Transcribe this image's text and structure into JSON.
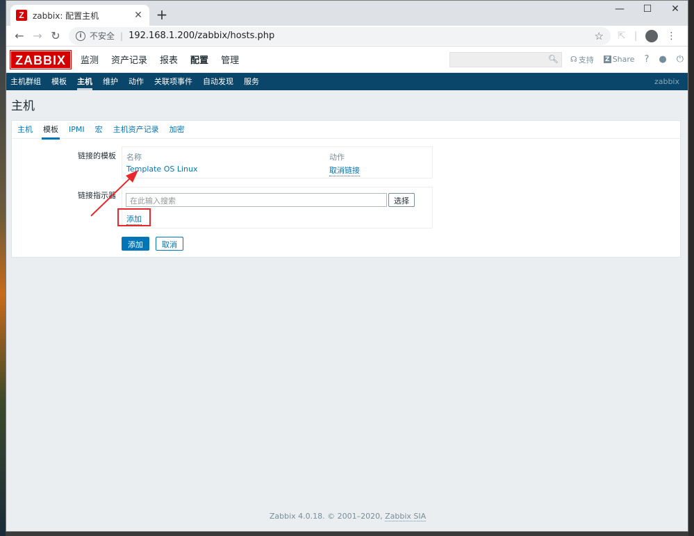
{
  "browser": {
    "tab_title": "zabbix: 配置主机",
    "security_label": "不安全",
    "url": "192.168.1.200/zabbix/hosts.php"
  },
  "header": {
    "logo": "ZABBIX",
    "menu": [
      "监测",
      "资产记录",
      "报表",
      "配置",
      "管理"
    ],
    "active_menu": "配置",
    "support_label": "支持",
    "share_label": "Share",
    "help_label": "?"
  },
  "subnav": {
    "items": [
      "主机群组",
      "模板",
      "主机",
      "维护",
      "动作",
      "关联项事件",
      "自动发现",
      "服务"
    ],
    "active": "主机",
    "user": "zabbix"
  },
  "page": {
    "title": "主机",
    "tabs": [
      "主机",
      "模板",
      "IPMI",
      "宏",
      "主机资产记录",
      "加密"
    ],
    "active_tab": "模板"
  },
  "form": {
    "linked_templates_label": "链接的模板",
    "col_name": "名称",
    "col_action": "动作",
    "template_name": "Template OS Linux",
    "unlink_label": "取消链接",
    "link_new_label": "链接指示器",
    "search_placeholder": "在此输入搜索",
    "select_button": "选择",
    "add_link": "添加",
    "add_button": "添加",
    "cancel_button": "取消"
  },
  "footer": {
    "text": "Zabbix 4.0.18. © 2001–2020, ",
    "company": "Zabbix SIA"
  },
  "colors": {
    "brand": "#d40000",
    "nav": "#0a466a",
    "link": "#0275b8",
    "highlight": "#e8282b"
  }
}
